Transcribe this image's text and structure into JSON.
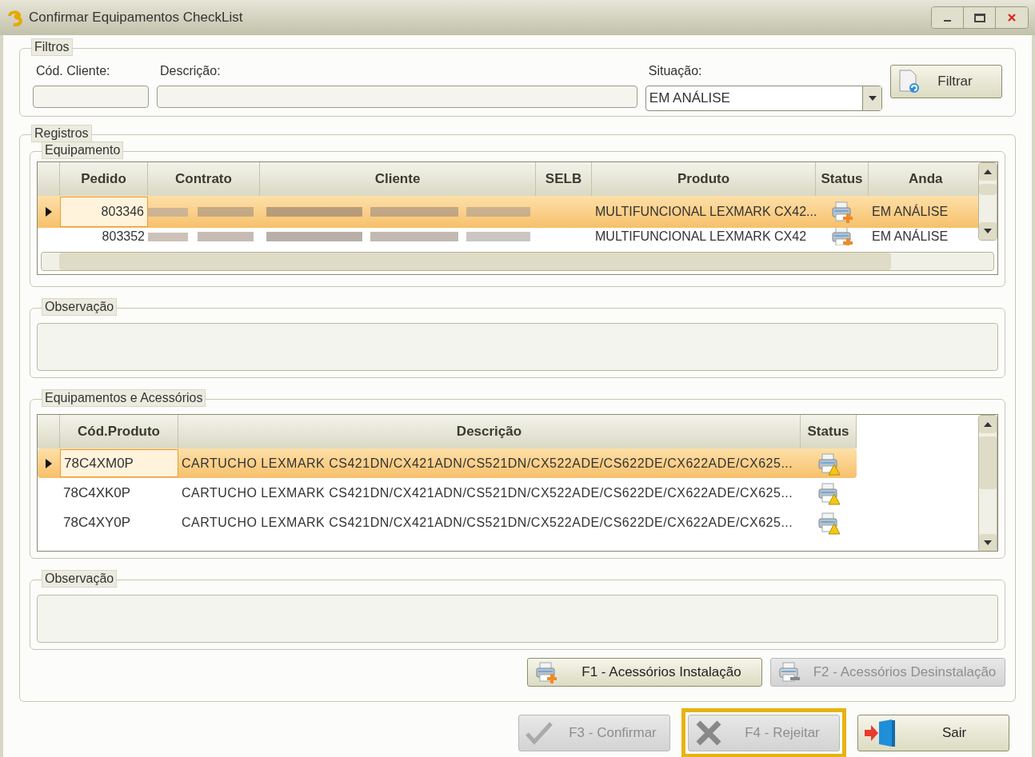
{
  "window": {
    "title": "Confirmar Equipamentos CheckList"
  },
  "filters": {
    "legend": "Filtros",
    "client_code": {
      "label": "Cód. Cliente:"
    },
    "description": {
      "label": "Descrição:"
    },
    "status": {
      "label": "Situação:",
      "value": "EM ANÁLISE"
    },
    "filter_button": "Filtrar"
  },
  "records": {
    "legend": "Registros",
    "equipment": {
      "legend": "Equipamento",
      "columns": [
        "Pedido",
        "Contrato",
        "Cliente",
        "SELB",
        "Produto",
        "Status",
        "Anda"
      ],
      "rows": [
        {
          "selected": true,
          "redacted": true,
          "pedido": "803346",
          "produto": "MULTIFUNCIONAL  LEXMARK  CX42...",
          "andamento": "EM ANÁLISE"
        },
        {
          "selected": false,
          "redacted": true,
          "pedido": "803352",
          "produto": "MULTIFUNCIONAL  LEXMARK  CX42",
          "andamento": "EM ANÁLISE"
        }
      ]
    },
    "observation_1": {
      "legend": "Observação"
    },
    "accessories": {
      "legend": "Equipamentos e Acessórios",
      "columns": [
        "Cód.Produto",
        "Descrição",
        "Status"
      ],
      "rows": [
        {
          "selected": true,
          "code": "78C4XM0P",
          "description": "CARTUCHO  LEXMARK  CS421DN/CX421ADN/CS521DN/CX522ADE/CS622DE/CX622ADE/CX625..."
        },
        {
          "selected": false,
          "code": "78C4XK0P",
          "description": "CARTUCHO  LEXMARK  CS421DN/CX421ADN/CS521DN/CX522ADE/CS622DE/CX622ADE/CX625..."
        },
        {
          "selected": false,
          "code": "78C4XY0P",
          "description": "CARTUCHO  LEXMARK  CS421DN/CX421ADN/CS521DN/CX522ADE/CS622DE/CX622ADE/CX625..."
        }
      ]
    },
    "observation_2": {
      "legend": "Observação"
    },
    "buttons": [
      {
        "label": "F1 - Acessórios Instalação",
        "kind": "install",
        "disabled": false
      },
      {
        "label": "F2 - Acessórios Desinstalação",
        "kind": "uninstall",
        "disabled": true
      }
    ]
  },
  "footer_buttons": [
    {
      "label": "F3 - Confirmar",
      "kind": "confirm",
      "disabled": true,
      "highlighted": false
    },
    {
      "label": "F4 - Rejeitar",
      "kind": "reject",
      "disabled": true,
      "highlighted": true
    },
    {
      "label": "Sair",
      "kind": "exit",
      "disabled": false,
      "highlighted": false
    }
  ]
}
